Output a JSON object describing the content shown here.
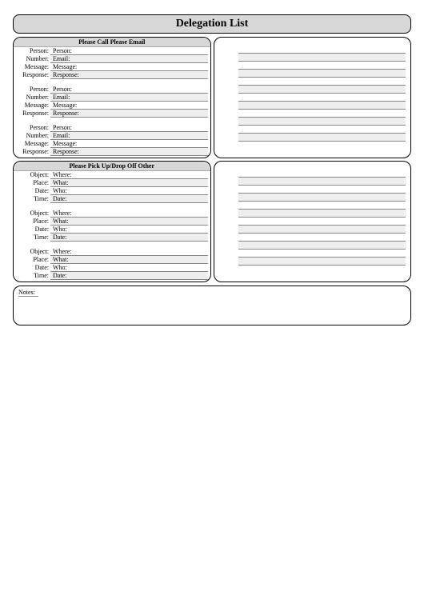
{
  "title": "Delegation List",
  "section1": {
    "header": "Please Call Please Email",
    "labelsA": [
      "Person:",
      "Number:",
      "Message:",
      "Response:"
    ],
    "labelsB": [
      "Person:",
      "Email:",
      "Message:",
      "Response:"
    ]
  },
  "section2": {
    "header": "Please Pick Up/Drop Off Other",
    "labelsA": [
      "Object:",
      "Place:",
      "Date:",
      "Time:"
    ],
    "labelsB": [
      "Where:",
      "What:",
      "Who:",
      "Date:"
    ]
  },
  "notesLabel": "Notes:"
}
